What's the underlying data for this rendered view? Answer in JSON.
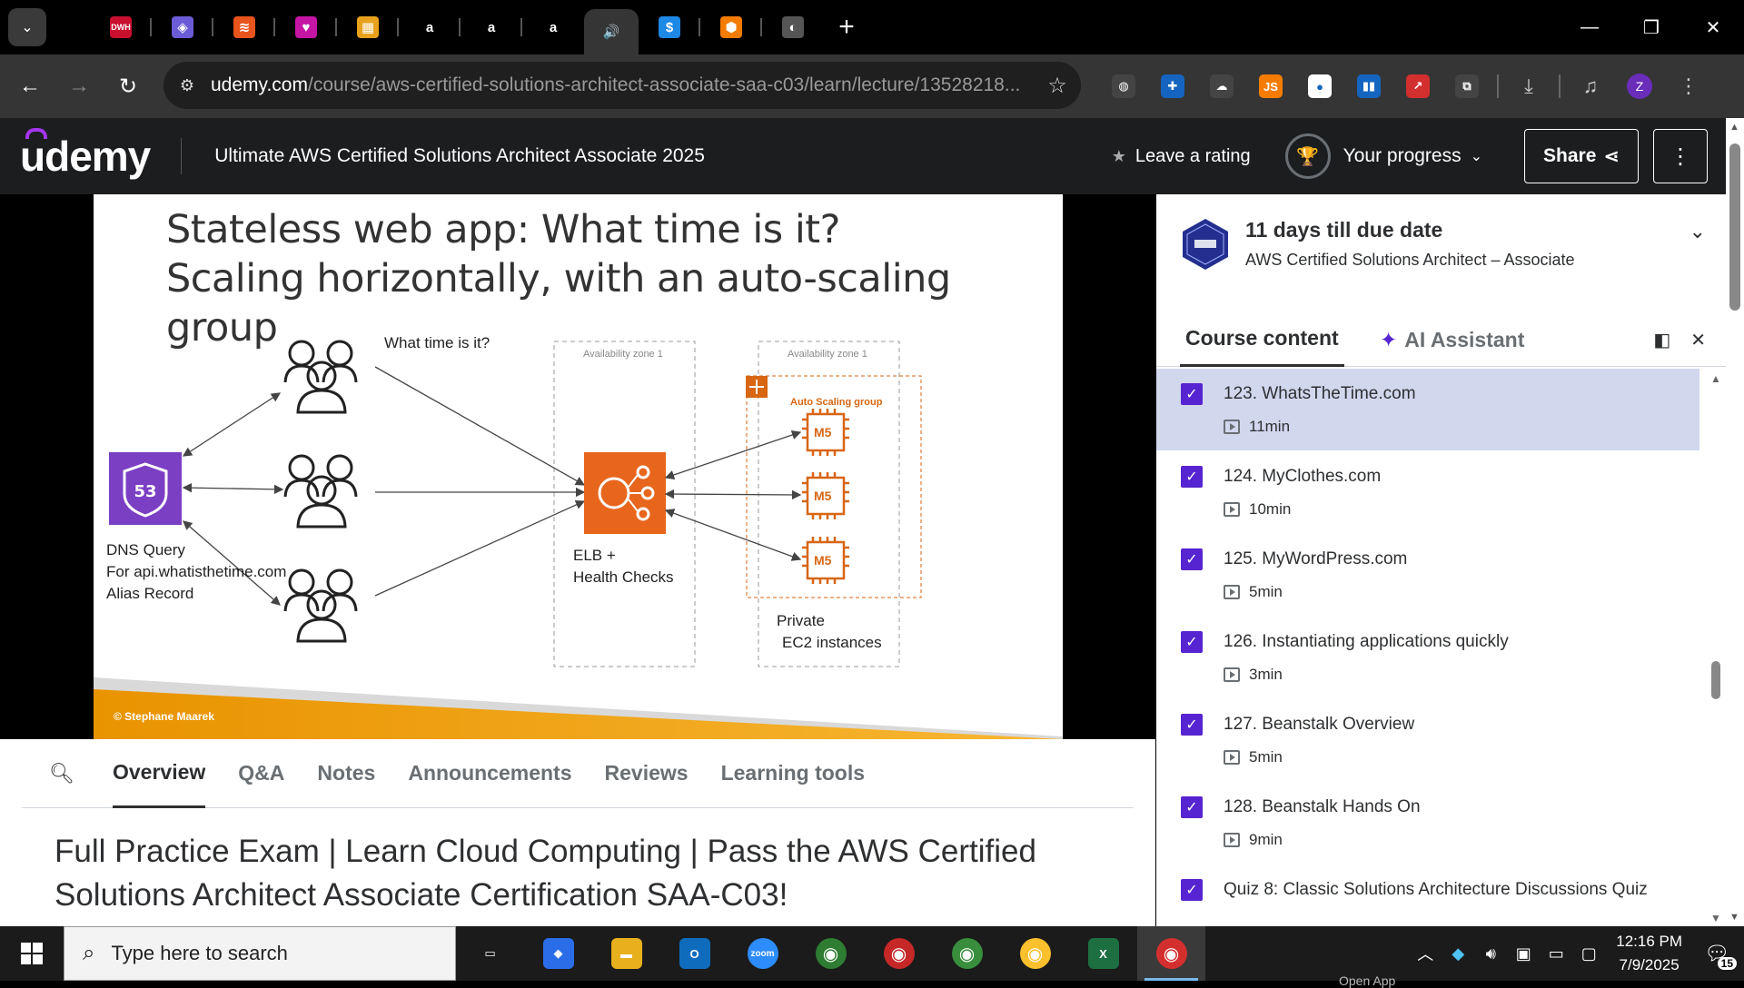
{
  "browser": {
    "tabs": [
      {
        "icon": "DWH",
        "color": "#c8102e",
        "name": "tab-dwh"
      },
      {
        "icon": "◈",
        "color": "#6b5bd6",
        "name": "tab-cube"
      },
      {
        "icon": "≋",
        "color": "#e8541c",
        "name": "tab-stack"
      },
      {
        "icon": "♥",
        "color": "#c515a5",
        "name": "tab-heart"
      },
      {
        "icon": "▦",
        "color": "#e8a11c",
        "name": "tab-package"
      },
      {
        "icon": "a",
        "color": "#000000",
        "name": "tab-amazon-1"
      },
      {
        "icon": "a",
        "color": "#000000",
        "name": "tab-amazon-2"
      },
      {
        "icon": "a",
        "color": "#000000",
        "name": "tab-amazon-3"
      },
      {
        "icon": "🔊",
        "color": "#353535",
        "name": "tab-active-audio",
        "active": true
      },
      {
        "icon": "$",
        "color": "#1e88e5",
        "name": "tab-dollar"
      },
      {
        "icon": "⬢",
        "color": "#f57c00",
        "name": "tab-hex"
      },
      {
        "icon": "◐",
        "color": "#555555",
        "name": "tab-globe"
      }
    ],
    "new_tab": "+",
    "url_host": "udemy.com",
    "url_path": "/course/aws-certified-solutions-architect-associate-saa-c03/learn/lecture/13528218...",
    "extensions": [
      {
        "icon": "◍",
        "color": "#444444",
        "name": "globe-extension-icon"
      },
      {
        "icon": "✚",
        "color": "#1565c0",
        "name": "plus-extension-icon"
      },
      {
        "icon": "☁",
        "color": "#444444",
        "name": "cloud-extension-icon"
      },
      {
        "icon": "JS",
        "color": "#f57c00",
        "name": "js-extension-icon"
      },
      {
        "icon": "●",
        "color": "#ffffff",
        "name": "circle-extension-icon"
      },
      {
        "icon": "▮▮",
        "color": "#1565c0",
        "name": "bars-extension-icon"
      },
      {
        "icon": "↗",
        "color": "#d32f2f",
        "name": "arrow-extension-icon"
      },
      {
        "icon": "⧉",
        "color": "#444444",
        "name": "puzzle-extension-icon"
      }
    ],
    "profile_initial": "Z"
  },
  "udemy": {
    "logo": "udemy",
    "course_title": "Ultimate AWS Certified Solutions Architect Associate 2025",
    "leave_rating": "Leave a rating",
    "your_progress": "Your progress",
    "share": "Share"
  },
  "slide": {
    "title_line1": "Stateless web app: What time is it?",
    "title_line2": "Scaling horizontally, with an auto-scaling group",
    "what_time": "What time is it?",
    "route53_label": "53",
    "dns_line1": "DNS Query",
    "dns_line2": "For api.whatisthetime.com",
    "dns_line3": "Alias Record",
    "az1": "Availability zone 1",
    "az2": "Availability zone 1",
    "asg": "Auto Scaling group",
    "m5": "M5",
    "elb_line1": "ELB +",
    "elb_line2": "Health Checks",
    "private_line1": "Private",
    "private_line2": "EC2 instances",
    "copyright": "© Stephane Maarek"
  },
  "sidebar": {
    "due_title": "11 days till due date",
    "due_sub": "AWS Certified Solutions Architect – Associate",
    "tab_course": "Course content",
    "tab_ai": "AI Assistant",
    "lectures": [
      {
        "title": "123. WhatsTheTime.com",
        "duration": "11min",
        "current": true
      },
      {
        "title": "124. MyClothes.com",
        "duration": "10min"
      },
      {
        "title": "125. MyWordPress.com",
        "duration": "5min"
      },
      {
        "title": "126. Instantiating applications quickly",
        "duration": "3min"
      },
      {
        "title": "127. Beanstalk Overview",
        "duration": "5min"
      },
      {
        "title": "128. Beanstalk Hands On",
        "duration": "9min"
      },
      {
        "title": "Quiz 8: Classic Solutions Architecture Discussions Quiz",
        "duration": ""
      }
    ]
  },
  "below": {
    "tabs": [
      "Overview",
      "Q&A",
      "Notes",
      "Announcements",
      "Reviews",
      "Learning tools"
    ],
    "headline": "Full Practice Exam | Learn Cloud Computing | Pass the AWS Certified Solutions Architect Associate Certification SAA-C03!"
  },
  "taskbar": {
    "search_placeholder": "Type here to search",
    "apps": [
      {
        "icon": "▭",
        "color": "#1b1b1b",
        "name": "task-view-icon"
      },
      {
        "icon": "◆",
        "color": "#2b6de8",
        "name": "copilot-icon"
      },
      {
        "icon": "▬",
        "color": "#e8b01c",
        "name": "file-explorer-icon"
      },
      {
        "icon": "O",
        "color": "#0f6cbd",
        "name": "outlook-icon"
      },
      {
        "icon": "zoom",
        "color": "#2d8cff",
        "name": "zoom-icon"
      },
      {
        "icon": "◉",
        "color": "#2e7d32",
        "name": "chrome-profile-1-icon"
      },
      {
        "icon": "◉",
        "color": "#c62828",
        "name": "chrome-profile-2-icon"
      },
      {
        "icon": "◉",
        "color": "#388e3c",
        "name": "chrome-profile-3-icon"
      },
      {
        "icon": "◉",
        "color": "#fbc02d",
        "name": "chrome-icon"
      },
      {
        "icon": "X",
        "color": "#1d6f42",
        "name": "excel-icon"
      },
      {
        "icon": "◉",
        "color": "#d32f2f",
        "name": "chrome-active-icon",
        "active": true
      }
    ],
    "time": "12:16 PM",
    "date": "7/9/2025",
    "notifications": "15",
    "open_app": "Open App"
  }
}
